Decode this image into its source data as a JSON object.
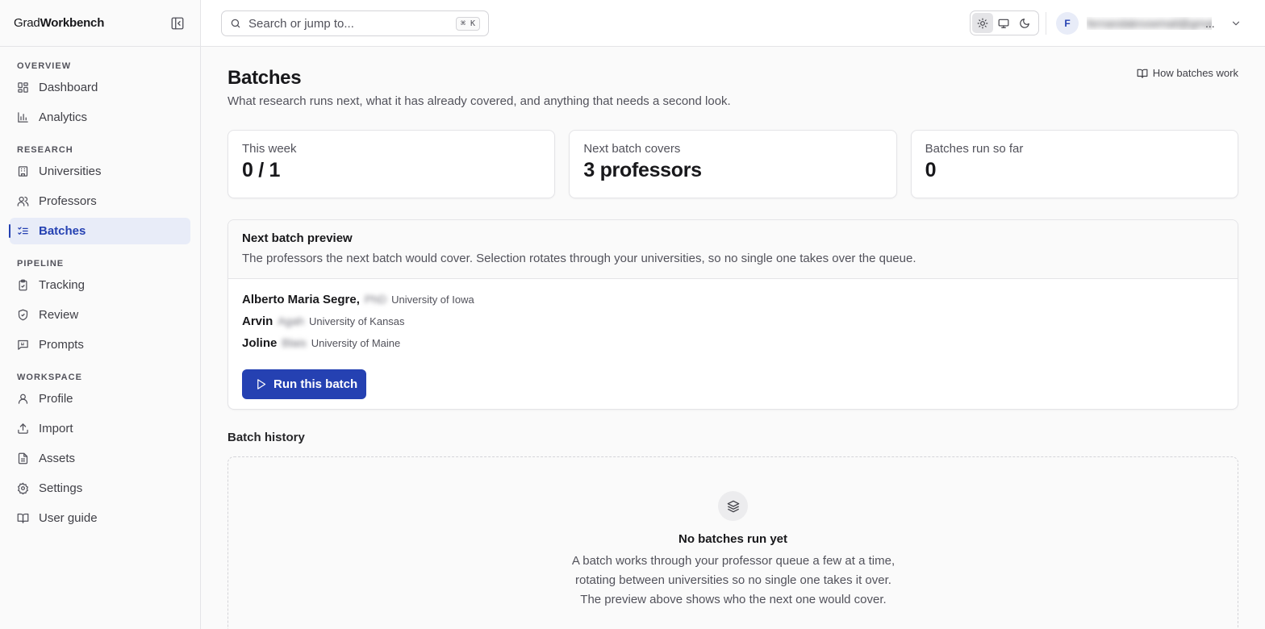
{
  "brand": {
    "prefix": "Grad",
    "suffix": "Workbench"
  },
  "sidebar": {
    "sections": [
      {
        "title": "OVERVIEW",
        "items": [
          {
            "label": "Dashboard",
            "icon": "dashboard-icon"
          },
          {
            "label": "Analytics",
            "icon": "bar-chart-icon"
          }
        ]
      },
      {
        "title": "RESEARCH",
        "items": [
          {
            "label": "Universities",
            "icon": "building-icon"
          },
          {
            "label": "Professors",
            "icon": "users-icon"
          },
          {
            "label": "Batches",
            "icon": "list-checks-icon",
            "active": true
          }
        ]
      },
      {
        "title": "PIPELINE",
        "items": [
          {
            "label": "Tracking",
            "icon": "clipboard-icon"
          },
          {
            "label": "Review",
            "icon": "shield-icon"
          },
          {
            "label": "Prompts",
            "icon": "message-icon"
          }
        ]
      },
      {
        "title": "WORKSPACE",
        "items": [
          {
            "label": "Profile",
            "icon": "user-icon"
          },
          {
            "label": "Import",
            "icon": "upload-icon"
          },
          {
            "label": "Assets",
            "icon": "file-icon"
          },
          {
            "label": "Settings",
            "icon": "gear-icon"
          },
          {
            "label": "User guide",
            "icon": "book-icon"
          }
        ]
      }
    ]
  },
  "topbar": {
    "search_placeholder": "Search or jump to...",
    "search_shortcut": "⌘ K",
    "avatar_initial": "F",
    "account_email": "fernandaknowmail@gmail.com",
    "account_ellipsis": "..."
  },
  "page": {
    "title": "Batches",
    "subtitle": "What research runs next, what it has already covered, and anything that needs a second look.",
    "help_link": "How batches work"
  },
  "stats": [
    {
      "label": "This week",
      "value": "0 / 1"
    },
    {
      "label": "Next batch covers",
      "value": "3 professors"
    },
    {
      "label": "Batches run so far",
      "value": "0"
    }
  ],
  "preview": {
    "title": "Next batch preview",
    "description": "The professors the next batch would cover. Selection rotates through your universities, so no single one takes over the queue.",
    "professors": [
      {
        "name": "Alberto Maria Segre,",
        "hidden": "PhD",
        "university": "University of Iowa"
      },
      {
        "name": "Arvin",
        "hidden": "Agah",
        "university": "University of Kansas"
      },
      {
        "name": "Joline",
        "hidden": "Blais",
        "university": "University of Maine"
      }
    ],
    "run_button": "Run this batch"
  },
  "history": {
    "title": "Batch history",
    "empty_title": "No batches run yet",
    "empty_text": "A batch works through your professor queue a few at a time, rotating between universities so no single one takes it over. The preview above shows who the next one would cover."
  },
  "colors": {
    "accent": "#2541b2",
    "accent_soft": "#e8ecf8"
  }
}
